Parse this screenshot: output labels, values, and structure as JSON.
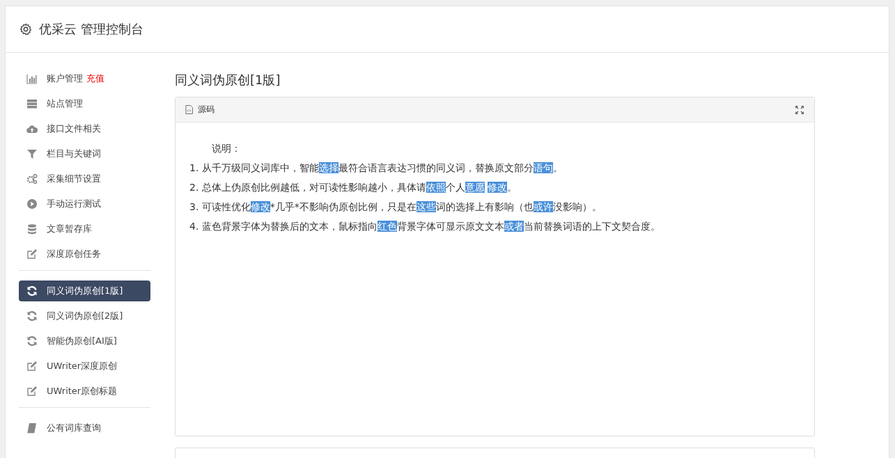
{
  "header": {
    "title": "优采云 管理控制台"
  },
  "sidebar": {
    "groups": [
      {
        "items": [
          {
            "label": "账户管理",
            "link": "充值",
            "selected": false
          },
          {
            "label": "站点管理",
            "selected": false
          },
          {
            "label": "接口文件相关",
            "selected": false
          },
          {
            "label": "栏目与关键词",
            "selected": false
          },
          {
            "label": "采集细节设置",
            "selected": false
          },
          {
            "label": "手动运行测试",
            "selected": false
          },
          {
            "label": "文章暂存库",
            "selected": false
          },
          {
            "label": "深度原创任务",
            "selected": false
          }
        ]
      },
      {
        "items": [
          {
            "label": "同义词伪原创[1版]",
            "selected": true
          },
          {
            "label": "同义词伪原创[2版]",
            "selected": false
          },
          {
            "label": "智能伪原创[AI版]",
            "selected": false
          },
          {
            "label": "UWriter深度原创",
            "selected": false
          },
          {
            "label": "UWriter原创标题",
            "selected": false
          }
        ]
      },
      {
        "items": [
          {
            "label": "公有词库查询",
            "selected": false
          }
        ]
      }
    ]
  },
  "content": {
    "title": "同义词伪原创[1版]",
    "panel": {
      "tab": "源码",
      "intro": "说明：",
      "lines": [
        [
          {
            "text": "1. 从千万级同义词库中，智能",
            "highlighted": false
          },
          {
            "text": "选择",
            "highlighted": true
          },
          {
            "text": "最符合语言表达习惯的同义词，替换原文部分",
            "highlighted": false
          },
          {
            "text": "语句",
            "highlighted": true
          },
          {
            "text": "。",
            "highlighted": false
          }
        ],
        [
          {
            "text": "2. 总体上伪原创比例越低，对可读性影响越小，具体请",
            "highlighted": false
          },
          {
            "text": "依照",
            "highlighted": true
          },
          {
            "text": "个人",
            "highlighted": false
          },
          {
            "text": "意愿",
            "highlighted": true
          },
          {
            "text": "修改",
            "highlighted": true
          },
          {
            "text": "。",
            "highlighted": false
          }
        ],
        [
          {
            "text": "3. 可读性优化",
            "highlighted": false
          },
          {
            "text": "修改",
            "highlighted": true
          },
          {
            "text": "*几乎*不影响伪原创比例，只是在",
            "highlighted": false
          },
          {
            "text": "这些",
            "highlighted": true
          },
          {
            "text": "词的选择上有影响（也",
            "highlighted": false
          },
          {
            "text": "或许",
            "highlighted": true
          },
          {
            "text": "没影响）。",
            "highlighted": false
          }
        ],
        [
          {
            "text": "4. 蓝色背景字体为替换后的文本，鼠标指向",
            "highlighted": false
          },
          {
            "text": "红色",
            "highlighted": true
          },
          {
            "text": "背景字体可显示原文文本",
            "highlighted": false
          },
          {
            "text": "或者",
            "highlighted": true
          },
          {
            "text": "当前替换词语的上下文契合度。",
            "highlighted": false
          }
        ]
      ]
    }
  }
}
